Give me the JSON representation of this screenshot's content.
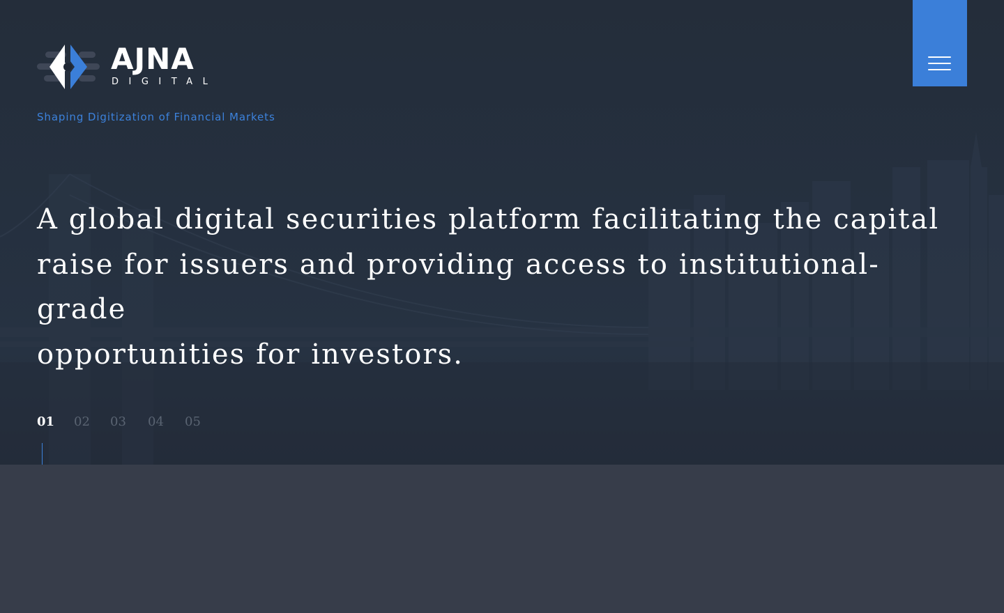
{
  "brand": {
    "name": "AJNA",
    "sub": "DIGITAL",
    "tagline": "Shaping Digitization of Financial Markets",
    "accent_color": "#3b7fd9"
  },
  "menu": {
    "icon": "hamburger-menu-icon"
  },
  "hero": {
    "headline_lines": [
      "A global digital securities platform facilitating the capital",
      "raise for issuers and providing access to institutional-grade",
      "opportunities for investors."
    ]
  },
  "slides": {
    "items": [
      "01",
      "02",
      "03",
      "04",
      "05"
    ],
    "active_index": 0
  }
}
